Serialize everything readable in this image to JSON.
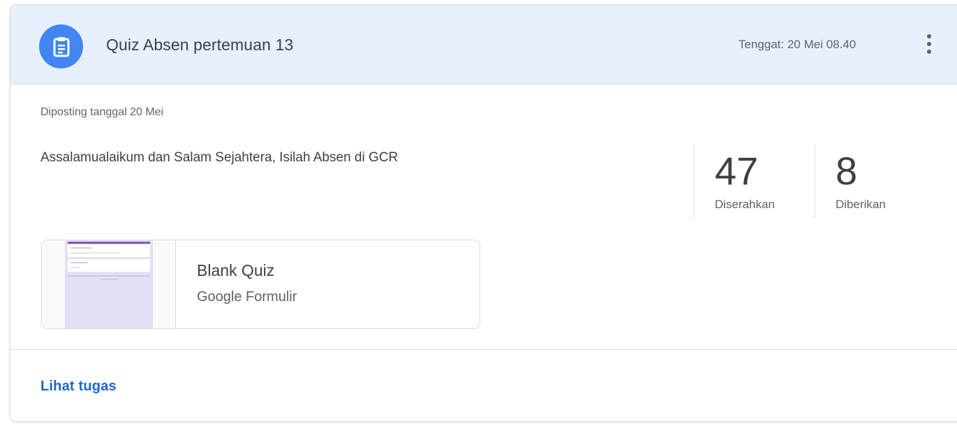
{
  "assignment": {
    "icon": "assignment-icon",
    "title": "Quiz Absen pertemuan 13",
    "due": "Tenggat: 20 Mei 08.40",
    "more_icon": "more-vert-icon",
    "posted": "Diposting tanggal 20 Mei",
    "instructions": "Assalamualaikum dan Salam Sejahtera, Isilah Absen di GCR"
  },
  "stats": {
    "submitted": {
      "value": "47",
      "label": "Diserahkan"
    },
    "assigned": {
      "value": "8",
      "label": "Diberikan"
    }
  },
  "attachment": {
    "title": "Blank Quiz",
    "type": "Google Formulir"
  },
  "footer": {
    "view_link": "Lihat tugas"
  },
  "colors": {
    "header_bg": "#e8f0fe",
    "icon_bg": "#4285f4",
    "link": "#1967d2",
    "form_accent": "#7e57c2"
  }
}
